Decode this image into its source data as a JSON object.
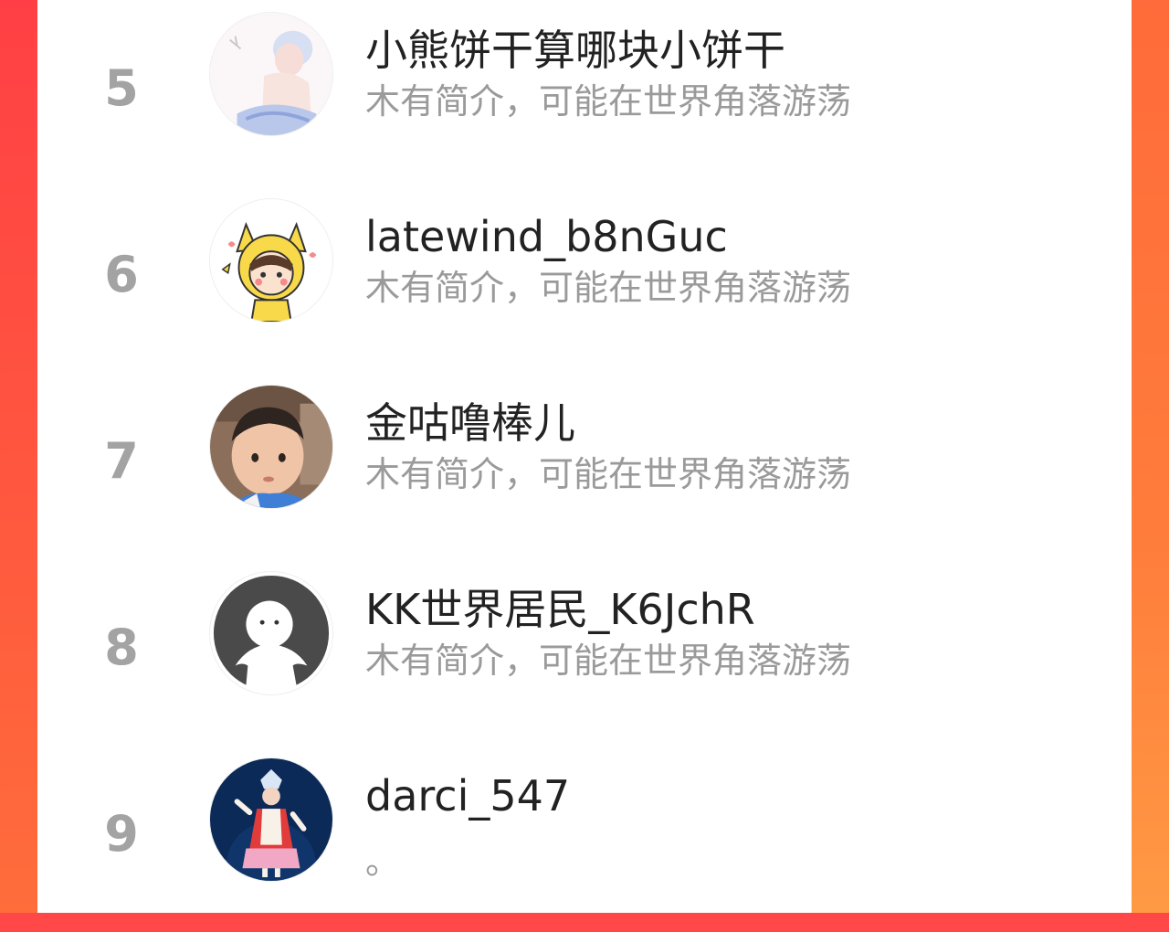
{
  "theme": {
    "accent_left": "#ff4747",
    "accent_right": "#ff8a3c",
    "card_bg": "#ffffff",
    "rank_color": "#a3a3a3",
    "name_color": "#222222",
    "bio_color": "#9a9a9a"
  },
  "users": [
    {
      "rank": "5",
      "name": "小熊饼干算哪块小饼干",
      "bio": "木有简介，可能在世界角落游荡",
      "avatar_icon": "anime-boy-avatar"
    },
    {
      "rank": "6",
      "name": "latewind_b8nGuc",
      "bio": "木有简介，可能在世界角落游荡",
      "avatar_icon": "pikachu-hood-girl-avatar"
    },
    {
      "rank": "7",
      "name": "金咕噜棒儿",
      "bio": "木有简介，可能在世界角落游荡",
      "avatar_icon": "toddler-photo-avatar"
    },
    {
      "rank": "8",
      "name": "KK世界居民_K6JchR",
      "bio": "木有简介，可能在世界角落游荡",
      "avatar_icon": "default-ghost-avatar"
    },
    {
      "rank": "9",
      "name": "darci_547",
      "bio": "。",
      "avatar_icon": "opera-performer-avatar"
    }
  ]
}
